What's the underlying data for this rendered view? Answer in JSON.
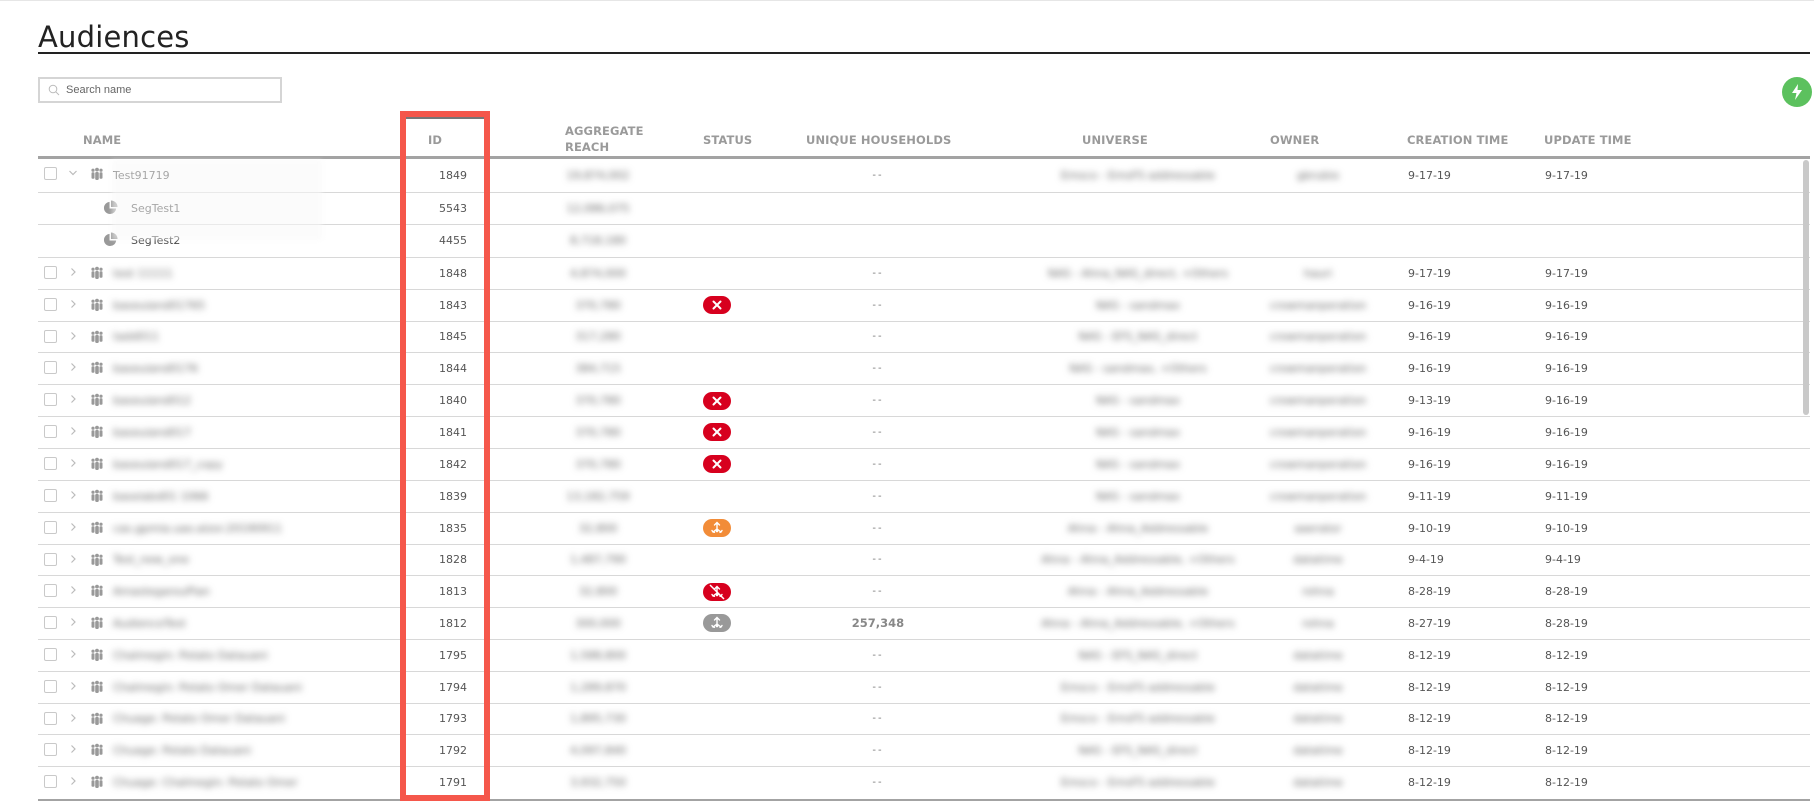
{
  "page": {
    "title": "Audiences",
    "search": {
      "placeholder": "Search name",
      "value": ""
    },
    "quick_action_icon": "lightning-bolt-icon",
    "colors": {
      "accent_green": "#5cc15e",
      "status_error": "#d7001e",
      "status_warning": "#f28c38",
      "status_neutral": "#999999",
      "highlight": "#f5574b"
    }
  },
  "table": {
    "columns": {
      "name": "NAME",
      "id": "ID",
      "aggregate_reach_1": "AGGREGATE",
      "aggregate_reach_2": "REACH",
      "status": "STATUS",
      "unique_households": "UNIQUE HOUSEHOLDS",
      "universe": "UNIVERSE",
      "owner": "OWNER",
      "creation_time": "CREATION TIME",
      "update_time": "UPDATE TIME"
    },
    "rows": [
      {
        "type": "audience",
        "expanded": true,
        "name": "Test91719",
        "id": "1849",
        "reach": "19,874,002",
        "status": "",
        "uh": "--",
        "universe": "Emsco - EmsFS addressable",
        "owner": "gbrubio",
        "created": "9-17-19",
        "updated": "9-17-19"
      },
      {
        "type": "segment",
        "name": "SegTest1",
        "id": "5543",
        "reach": "12,086,075",
        "status": "",
        "uh": "",
        "universe": "",
        "owner": "",
        "created": "",
        "updated": ""
      },
      {
        "type": "segment",
        "name": "SegTest2",
        "id": "4455",
        "reach": "8,718,180",
        "status": "",
        "uh": "",
        "universe": "",
        "owner": "",
        "created": "",
        "updated": ""
      },
      {
        "type": "audience",
        "expanded": false,
        "name": "test 11111",
        "id": "1848",
        "reach": "4,874,000",
        "status": "",
        "uh": "--",
        "universe": "NAS - Ahna_NAS_direct, +Others",
        "owner": "hauri",
        "created": "9-17-19",
        "updated": "9-17-19"
      },
      {
        "type": "audience",
        "expanded": false,
        "name": "baseuiand01765",
        "id": "1843",
        "reach": "370,780",
        "status": "error",
        "uh": "--",
        "universe": "NAS - sandmax",
        "owner": "crowmanperation",
        "created": "9-16-19",
        "updated": "9-16-19"
      },
      {
        "type": "audience",
        "expanded": false,
        "name": "tadd011",
        "id": "1845",
        "reach": "317,280",
        "status": "",
        "uh": "--",
        "universe": "NAS - EFS_NAS_direct",
        "owner": "crowmanperation",
        "created": "9-16-19",
        "updated": "9-16-19"
      },
      {
        "type": "audience",
        "expanded": false,
        "name": "baseuiand0176",
        "id": "1844",
        "reach": "384,715",
        "status": "",
        "uh": "--",
        "universe": "NAS - sandmax, +Others",
        "owner": "crowmanperation",
        "created": "9-16-19",
        "updated": "9-16-19"
      },
      {
        "type": "audience",
        "expanded": false,
        "name": "baseuiand012",
        "id": "1840",
        "reach": "370,780",
        "status": "error",
        "uh": "--",
        "universe": "NAS - sandmax",
        "owner": "crowmanperation",
        "created": "9-13-19",
        "updated": "9-16-19"
      },
      {
        "type": "audience",
        "expanded": false,
        "name": "baseuiand017",
        "id": "1841",
        "reach": "370,780",
        "status": "error",
        "uh": "--",
        "universe": "NAS - sandmax",
        "owner": "crowmanperation",
        "created": "9-16-19",
        "updated": "9-16-19"
      },
      {
        "type": "audience",
        "expanded": false,
        "name": "baseuiand017_copy",
        "id": "1842",
        "reach": "370,780",
        "status": "error",
        "uh": "--",
        "universe": "NAS - sandmax",
        "owner": "crowmanperation",
        "created": "9-16-19",
        "updated": "9-16-19"
      },
      {
        "type": "audience",
        "expanded": false,
        "name": "baseiabd01 1066",
        "id": "1839",
        "reach": "13,182,759",
        "status": "",
        "uh": "--",
        "universe": "NAS - sandmax",
        "owner": "crowmanperation",
        "created": "9-11-19",
        "updated": "9-11-19"
      },
      {
        "type": "audience",
        "expanded": false,
        "name": "cas.gpmia.uao.alzor.20190911",
        "id": "1835",
        "reach": "32,800",
        "status": "distribution-warning",
        "uh": "--",
        "universe": "Ahna - Ahna_Addressable",
        "owner": "aaerator",
        "created": "9-10-19",
        "updated": "9-10-19"
      },
      {
        "type": "audience",
        "expanded": false,
        "name": "Test_new_one",
        "id": "1828",
        "reach": "1,487,790",
        "status": "",
        "uh": "--",
        "universe": "Ahna - Ahna_Addressable, +Others",
        "owner": "datatime",
        "created": "9-4-19",
        "updated": "9-4-19"
      },
      {
        "type": "audience",
        "expanded": false,
        "name": "AmastegarouPlan",
        "id": "1813",
        "reach": "32,800",
        "status": "distribution-disabled",
        "uh": "--",
        "universe": "Ahna - Ahna_Addressable",
        "owner": "rohna",
        "created": "8-28-19",
        "updated": "8-28-19"
      },
      {
        "type": "audience",
        "expanded": false,
        "name": "AudienceTest",
        "id": "1812",
        "reach": "300,000",
        "status": "distribution-neutral",
        "uh": "257,348",
        "universe": "Ahna - Ahna_Addressable, +Others",
        "owner": "rohna",
        "created": "8-27-19",
        "updated": "8-28-19"
      },
      {
        "type": "audience",
        "expanded": false,
        "name": "Chalmegin: Potato Datauani",
        "id": "1795",
        "reach": "1,588,800",
        "status": "",
        "uh": "--",
        "universe": "NAS - EFS_NAS_direct",
        "owner": "datatime",
        "created": "8-12-19",
        "updated": "8-12-19"
      },
      {
        "type": "audience",
        "expanded": false,
        "name": "Chalmegin: Potato Omer Datauani",
        "id": "1794",
        "reach": "1,289,870",
        "status": "",
        "uh": "--",
        "universe": "Emsco - EmsFS addressable",
        "owner": "datatime",
        "created": "8-12-19",
        "updated": "8-12-19"
      },
      {
        "type": "audience",
        "expanded": false,
        "name": "Chuage: Potato Omer Datauani",
        "id": "1793",
        "reach": "1,895,730",
        "status": "",
        "uh": "--",
        "universe": "Emsco - EmsFS addressable",
        "owner": "datatime",
        "created": "8-12-19",
        "updated": "8-12-19"
      },
      {
        "type": "audience",
        "expanded": false,
        "name": "Chuage: Potato Datauani",
        "id": "1792",
        "reach": "4,097,840",
        "status": "",
        "uh": "--",
        "universe": "NAS - EFS_NAS_direct",
        "owner": "datatime",
        "created": "8-12-19",
        "updated": "8-12-19"
      },
      {
        "type": "audience",
        "expanded": false,
        "name": "Chuage: Chalmegin: Potato Omer",
        "id": "1791",
        "reach": "3,932,750",
        "status": "",
        "uh": "--",
        "universe": "Emsco - EmsFS addressable",
        "owner": "datatime",
        "created": "8-12-19",
        "updated": "8-12-19"
      }
    ]
  }
}
